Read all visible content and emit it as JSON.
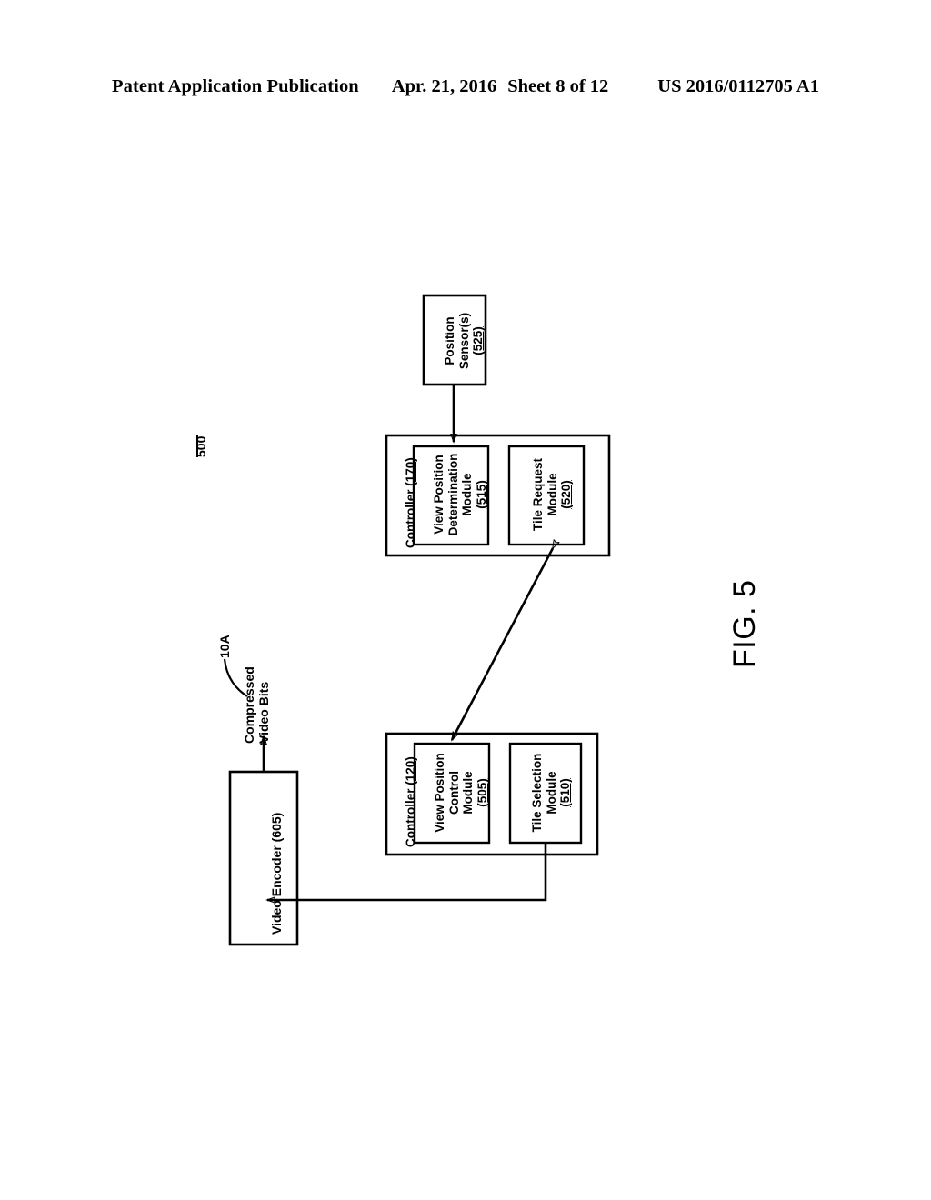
{
  "header": {
    "publication": "Patent Application Publication",
    "date": "Apr. 21, 2016",
    "sheet": "Sheet 8 of 12",
    "patent_number": "US 2016/0112705 A1"
  },
  "figure": {
    "label": "FIG. 5",
    "system_reference": "500",
    "signal_reference": "10A"
  },
  "labels": {
    "compressed_video_bits_line1": "Compressed",
    "compressed_video_bits_line2": "Video Bits"
  },
  "blocks": {
    "position_sensors": {
      "line1": "Position",
      "line2": "Sensor(s)",
      "ref": "(525)"
    },
    "controller_170": {
      "title": "Controller (",
      "title_ref": "170",
      "title_close": ")",
      "modules": [
        {
          "line1": "View Position",
          "line2": "Determination",
          "line3": "Module",
          "ref": "(515)"
        },
        {
          "line1": "Tile Request",
          "line2": "Module",
          "ref": "(520)"
        }
      ]
    },
    "controller_120": {
      "title": "Controller (",
      "title_ref": "120",
      "title_close": ")",
      "modules": [
        {
          "line1": "View Position",
          "line2": "Control",
          "line3": "Module",
          "ref": "(505)"
        },
        {
          "line1": "Tile Selection",
          "line2": "Module",
          "ref": "(510)"
        }
      ]
    },
    "video_encoder": {
      "label": "Video Encoder (605)"
    }
  },
  "style": {
    "ink": "#000000",
    "paper": "#ffffff"
  }
}
